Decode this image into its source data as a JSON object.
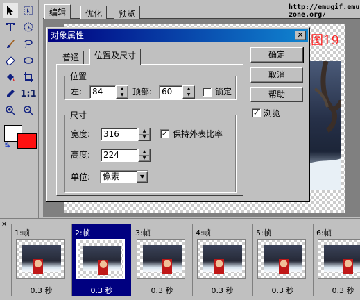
{
  "editor": {
    "tabs": [
      "编辑",
      "优化",
      "预览"
    ],
    "active_tab": "编辑",
    "url_text": "http://emugif.emu-zone.org/",
    "figure_label": "图19"
  },
  "toolbox": {
    "tools": [
      "pointer-tool",
      "marquee-tool",
      "text-tool",
      "ellipse-select-tool",
      "brush-tool",
      "lasso-tool",
      "eraser-tool",
      "ellipse-tool",
      "fill-tool",
      "crop-tool",
      "eyedropper-tool",
      "actual-size-tool",
      "zoom-in-tool",
      "zoom-out-tool"
    ],
    "foreground_color": "#ffffff",
    "background_color": "#ff1010"
  },
  "dialog": {
    "title": "对象属性",
    "close_label": "✕",
    "tabs": [
      "普通",
      "位置及尺寸"
    ],
    "active_tab": "位置及尺寸",
    "position": {
      "group_title": "位置",
      "left_label": "左:",
      "left_value": "84",
      "top_label": "顶部:",
      "top_value": "60",
      "lock_label": "锁定",
      "lock_checked": false
    },
    "size": {
      "group_title": "尺寸",
      "width_label": "宽度:",
      "width_value": "316",
      "keep_ratio_label": "保持外表比率",
      "keep_ratio_checked": true,
      "height_label": "高度:",
      "height_value": "224",
      "unit_label": "单位:",
      "unit_value": "像素"
    },
    "buttons": {
      "ok": "确定",
      "cancel": "取消",
      "help": "帮助",
      "preview_label": "浏览",
      "preview_checked": true
    }
  },
  "frames": {
    "close_label": "✕",
    "selected_index": 1,
    "items": [
      {
        "label": "1:帧",
        "delay": "0.3 秒"
      },
      {
        "label": "2:帧",
        "delay": "0.3 秒"
      },
      {
        "label": "3:帧",
        "delay": "0.3 秒"
      },
      {
        "label": "4:帧",
        "delay": "0.3 秒"
      },
      {
        "label": "5:帧",
        "delay": "0.3 秒"
      },
      {
        "label": "6:帧",
        "delay": "0.3 秒"
      }
    ]
  }
}
